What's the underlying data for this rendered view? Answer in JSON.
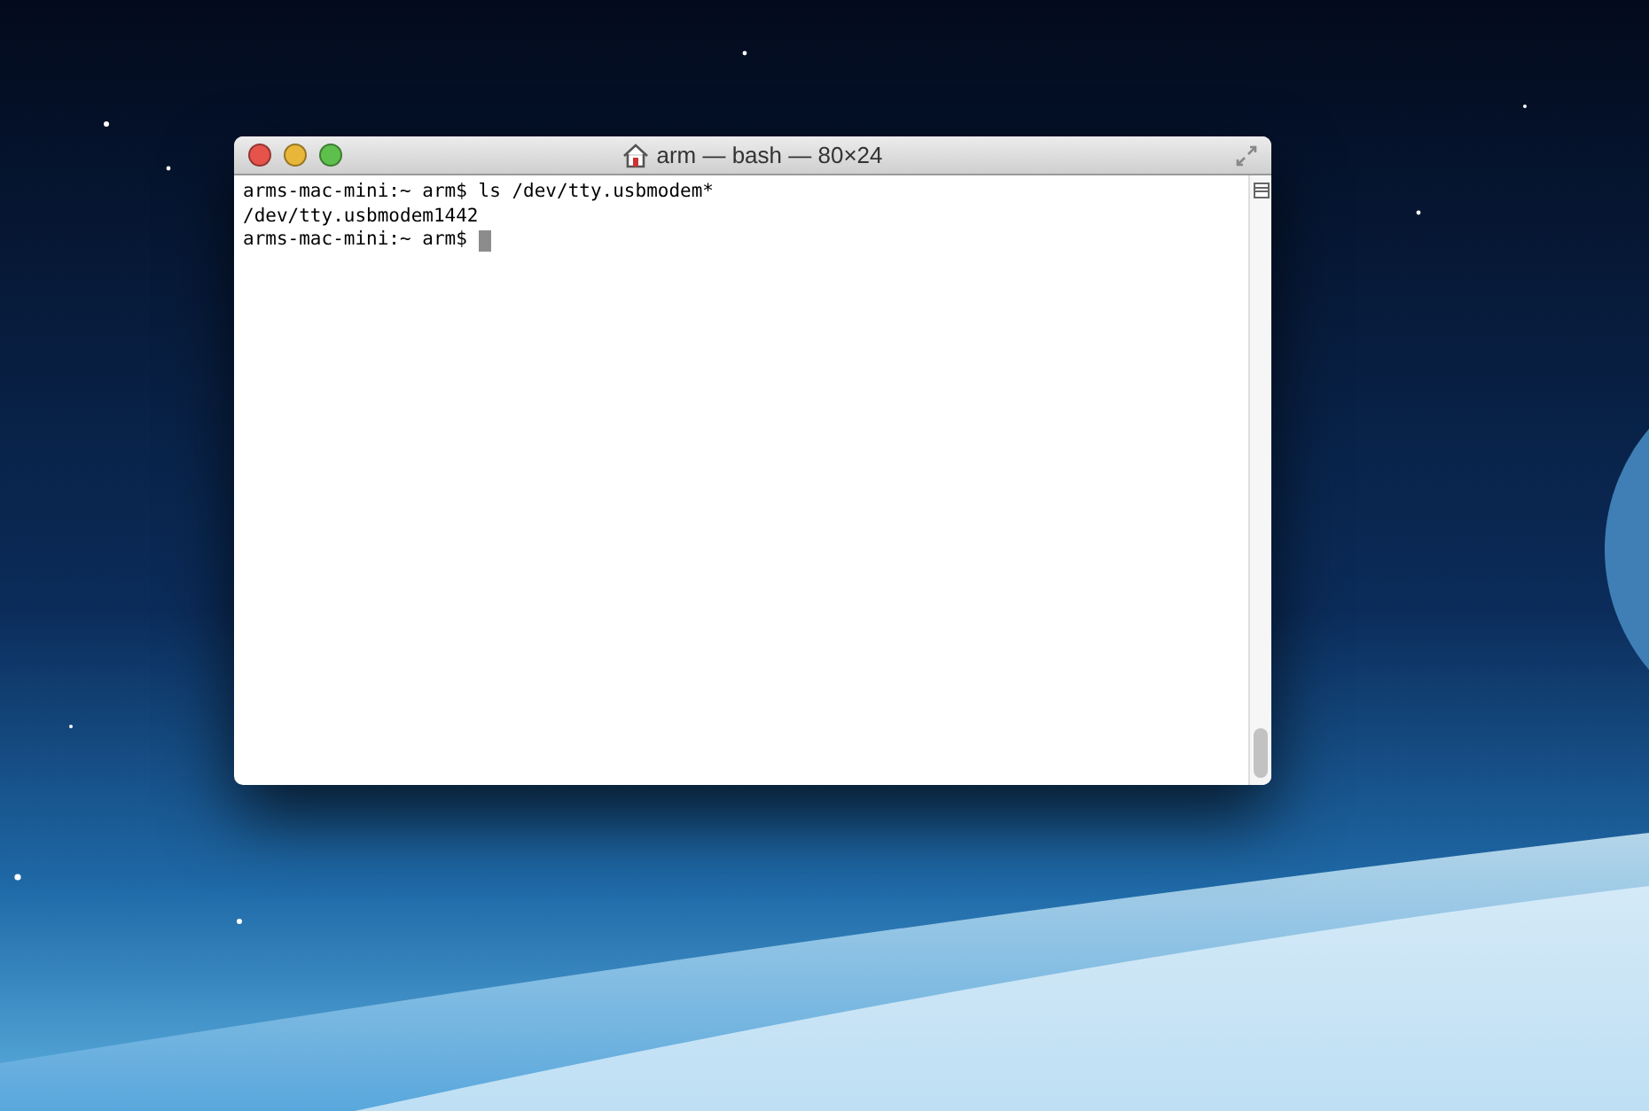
{
  "window": {
    "title": "arm — bash — 80×24"
  },
  "terminal": {
    "lines": [
      "arms-mac-mini:~ arm$ ls /dev/tty.usbmodem*",
      "/dev/tty.usbmodem1442",
      "arms-mac-mini:~ arm$ "
    ],
    "cursor": true
  }
}
